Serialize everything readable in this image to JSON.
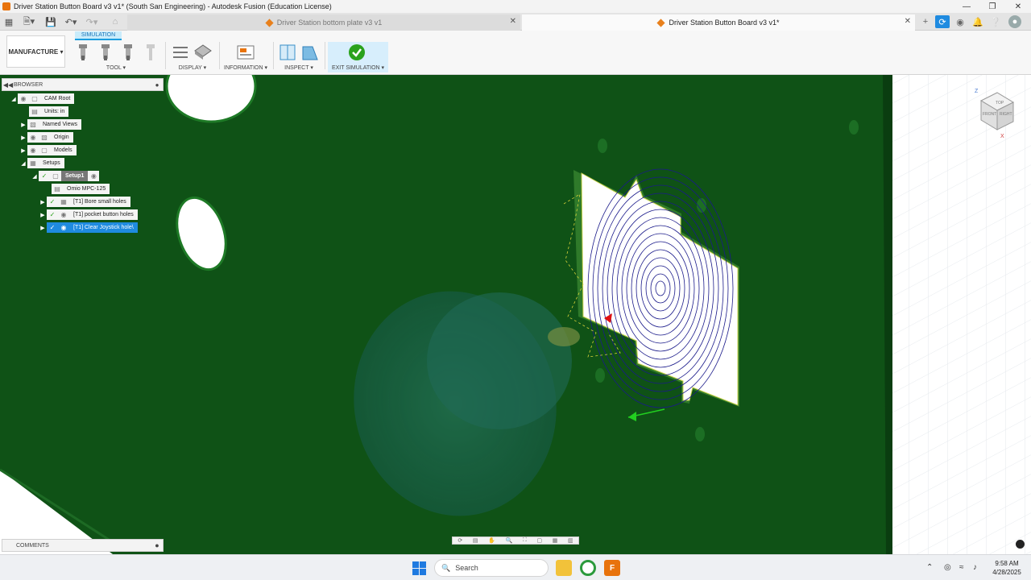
{
  "window": {
    "title": "Driver Station Button Board v3 v1* (South San Engineering) - Autodesk Fusion (Education License)"
  },
  "tabs": [
    {
      "label": "Driver Station bottom plate v3 v1",
      "active": false
    },
    {
      "label": "Driver Station Button Board v3 v1*",
      "active": true
    }
  ],
  "ribbon": {
    "workspace": "MANUFACTURE ▾",
    "context_tab": "SIMULATION",
    "groups": {
      "tool": "TOOL ▾",
      "display": "DISPLAY ▾",
      "information": "INFORMATION ▾",
      "inspect": "INSPECT ▾",
      "exit": "EXIT SIMULATION ▾"
    }
  },
  "browser": {
    "header": "BROWSER",
    "items": [
      {
        "label": "CAM Root"
      },
      {
        "label": "Units: in"
      },
      {
        "label": "Named Views"
      },
      {
        "label": "Origin"
      },
      {
        "label": "Models"
      },
      {
        "label": "Setups"
      },
      {
        "label": "Setup1"
      },
      {
        "label": "Omio MPC-125"
      },
      {
        "label": "[T1] Bore small holes"
      },
      {
        "label": "[T1] pocket button holes"
      },
      {
        "label": "[T1] Clear Joystick hole\\"
      }
    ]
  },
  "comments": {
    "label": "COMMENTS"
  },
  "viewcube": {
    "top": "TOP",
    "front": "FRONT",
    "right": "RIGHT",
    "axis_z": "Z",
    "axis_x": "X"
  },
  "taskbar": {
    "search_placeholder": "Search",
    "time": "9:58 AM",
    "date": "4/28/2025"
  },
  "colors": {
    "stock_green": "#0f5216",
    "accent_blue": "#1f8be0",
    "fusion_orange": "#e8730c"
  }
}
